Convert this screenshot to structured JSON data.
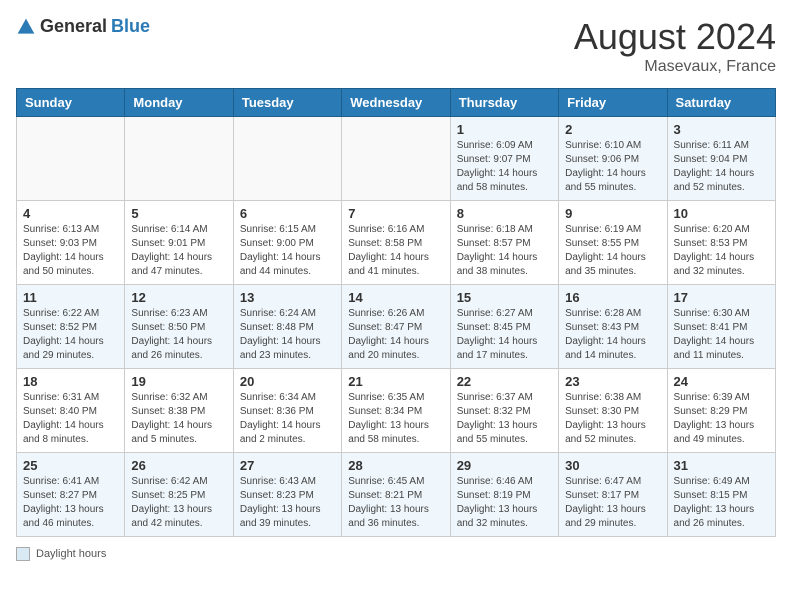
{
  "header": {
    "logo_general": "General",
    "logo_blue": "Blue",
    "month_year": "August 2024",
    "location": "Masevaux, France"
  },
  "days_of_week": [
    "Sunday",
    "Monday",
    "Tuesday",
    "Wednesday",
    "Thursday",
    "Friday",
    "Saturday"
  ],
  "footer": {
    "label": "Daylight hours"
  },
  "weeks": [
    {
      "days": [
        {
          "empty": true
        },
        {
          "empty": true
        },
        {
          "empty": true
        },
        {
          "empty": true
        },
        {
          "number": "1",
          "sunrise": "6:09 AM",
          "sunset": "9:07 PM",
          "daylight": "14 hours and 58 minutes."
        },
        {
          "number": "2",
          "sunrise": "6:10 AM",
          "sunset": "9:06 PM",
          "daylight": "14 hours and 55 minutes."
        },
        {
          "number": "3",
          "sunrise": "6:11 AM",
          "sunset": "9:04 PM",
          "daylight": "14 hours and 52 minutes."
        }
      ]
    },
    {
      "days": [
        {
          "number": "4",
          "sunrise": "6:13 AM",
          "sunset": "9:03 PM",
          "daylight": "14 hours and 50 minutes."
        },
        {
          "number": "5",
          "sunrise": "6:14 AM",
          "sunset": "9:01 PM",
          "daylight": "14 hours and 47 minutes."
        },
        {
          "number": "6",
          "sunrise": "6:15 AM",
          "sunset": "9:00 PM",
          "daylight": "14 hours and 44 minutes."
        },
        {
          "number": "7",
          "sunrise": "6:16 AM",
          "sunset": "8:58 PM",
          "daylight": "14 hours and 41 minutes."
        },
        {
          "number": "8",
          "sunrise": "6:18 AM",
          "sunset": "8:57 PM",
          "daylight": "14 hours and 38 minutes."
        },
        {
          "number": "9",
          "sunrise": "6:19 AM",
          "sunset": "8:55 PM",
          "daylight": "14 hours and 35 minutes."
        },
        {
          "number": "10",
          "sunrise": "6:20 AM",
          "sunset": "8:53 PM",
          "daylight": "14 hours and 32 minutes."
        }
      ]
    },
    {
      "days": [
        {
          "number": "11",
          "sunrise": "6:22 AM",
          "sunset": "8:52 PM",
          "daylight": "14 hours and 29 minutes."
        },
        {
          "number": "12",
          "sunrise": "6:23 AM",
          "sunset": "8:50 PM",
          "daylight": "14 hours and 26 minutes."
        },
        {
          "number": "13",
          "sunrise": "6:24 AM",
          "sunset": "8:48 PM",
          "daylight": "14 hours and 23 minutes."
        },
        {
          "number": "14",
          "sunrise": "6:26 AM",
          "sunset": "8:47 PM",
          "daylight": "14 hours and 20 minutes."
        },
        {
          "number": "15",
          "sunrise": "6:27 AM",
          "sunset": "8:45 PM",
          "daylight": "14 hours and 17 minutes."
        },
        {
          "number": "16",
          "sunrise": "6:28 AM",
          "sunset": "8:43 PM",
          "daylight": "14 hours and 14 minutes."
        },
        {
          "number": "17",
          "sunrise": "6:30 AM",
          "sunset": "8:41 PM",
          "daylight": "14 hours and 11 minutes."
        }
      ]
    },
    {
      "days": [
        {
          "number": "18",
          "sunrise": "6:31 AM",
          "sunset": "8:40 PM",
          "daylight": "14 hours and 8 minutes."
        },
        {
          "number": "19",
          "sunrise": "6:32 AM",
          "sunset": "8:38 PM",
          "daylight": "14 hours and 5 minutes."
        },
        {
          "number": "20",
          "sunrise": "6:34 AM",
          "sunset": "8:36 PM",
          "daylight": "14 hours and 2 minutes."
        },
        {
          "number": "21",
          "sunrise": "6:35 AM",
          "sunset": "8:34 PM",
          "daylight": "13 hours and 58 minutes."
        },
        {
          "number": "22",
          "sunrise": "6:37 AM",
          "sunset": "8:32 PM",
          "daylight": "13 hours and 55 minutes."
        },
        {
          "number": "23",
          "sunrise": "6:38 AM",
          "sunset": "8:30 PM",
          "daylight": "13 hours and 52 minutes."
        },
        {
          "number": "24",
          "sunrise": "6:39 AM",
          "sunset": "8:29 PM",
          "daylight": "13 hours and 49 minutes."
        }
      ]
    },
    {
      "days": [
        {
          "number": "25",
          "sunrise": "6:41 AM",
          "sunset": "8:27 PM",
          "daylight": "13 hours and 46 minutes."
        },
        {
          "number": "26",
          "sunrise": "6:42 AM",
          "sunset": "8:25 PM",
          "daylight": "13 hours and 42 minutes."
        },
        {
          "number": "27",
          "sunrise": "6:43 AM",
          "sunset": "8:23 PM",
          "daylight": "13 hours and 39 minutes."
        },
        {
          "number": "28",
          "sunrise": "6:45 AM",
          "sunset": "8:21 PM",
          "daylight": "13 hours and 36 minutes."
        },
        {
          "number": "29",
          "sunrise": "6:46 AM",
          "sunset": "8:19 PM",
          "daylight": "13 hours and 32 minutes."
        },
        {
          "number": "30",
          "sunrise": "6:47 AM",
          "sunset": "8:17 PM",
          "daylight": "13 hours and 29 minutes."
        },
        {
          "number": "31",
          "sunrise": "6:49 AM",
          "sunset": "8:15 PM",
          "daylight": "13 hours and 26 minutes."
        }
      ]
    }
  ]
}
